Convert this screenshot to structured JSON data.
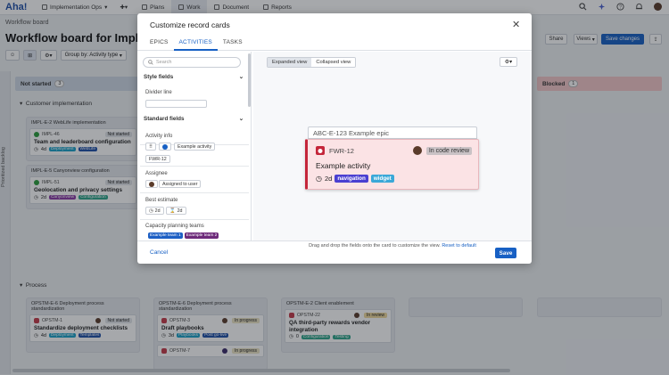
{
  "topnav": {
    "logo": "Aha!",
    "workspace": "Implementation Ops",
    "items": [
      {
        "label": "Plans"
      },
      {
        "label": "Work"
      },
      {
        "label": "Document"
      },
      {
        "label": "Reports"
      }
    ]
  },
  "page": {
    "breadcrumb": "Workflow board",
    "title": "Workflow board for Implem",
    "share_label": "Share",
    "views_label": "Views",
    "save_changes_label": "Save changes",
    "group_by_label": "Group by: Activity type",
    "side_tab_label": "Prioritized backlog"
  },
  "board": {
    "columns": [
      {
        "name": "Not started",
        "count": "3"
      },
      {
        "name": "Blocked",
        "count": "1"
      }
    ],
    "groups": [
      {
        "name": "Customer implementation"
      },
      {
        "name": "Process"
      }
    ],
    "customer_lanes": [
      {
        "title": "IMPL-E-2 WebLife implementation",
        "card": {
          "id": "IMPL-46",
          "title": "Team and leaderboard configuration",
          "estimate": "4d",
          "status": "Not started",
          "tags": [
            {
              "label": "Deployment",
              "color": "#1aa2c9"
            },
            {
              "label": "WebLife",
              "color": "#1d4fa8"
            }
          ]
        }
      },
      {
        "title": "IMPL-E-5 Canyonview configuration",
        "card": {
          "id": "IMPL-51",
          "title": "Geolocation and privacy settings",
          "estimate": "2d",
          "status": "Not started",
          "tags": [
            {
              "label": "Canyonview",
              "color": "#8b3aa6"
            },
            {
              "label": "Configuration",
              "color": "#2ea58a"
            }
          ]
        }
      }
    ],
    "process_lanes": [
      {
        "title": "OPSTM-E-6 Deployment process standardization",
        "card": {
          "id": "OPSTM-1",
          "title": "Standardize deployment checklists",
          "estimate": "4d",
          "status": "Not started",
          "status_color": "#e3e6ea",
          "tags": [
            {
              "label": "Deployment",
              "color": "#1aa2c9"
            },
            {
              "label": "Templates",
              "color": "#1d4fa8"
            }
          ]
        }
      },
      {
        "title": "OPSTM-E-6 Deployment process standardization",
        "card": {
          "id": "OPSTM-3",
          "title": "Draft playbooks",
          "estimate": "3d",
          "status": "In progress",
          "status_color": "#ece4c4",
          "tags": [
            {
              "label": "Playbooks",
              "color": "#1aa2c9"
            },
            {
              "label": "Post go-live",
              "color": "#1d4fa8"
            }
          ]
        },
        "card2": {
          "id": "OPSTM-7",
          "status": "In progress"
        }
      },
      {
        "title": "OPSTM-E-2 Client enablement",
        "card": {
          "id": "OPSTM-22",
          "title": "QA third-party rewards vendor integration",
          "estimate": "0",
          "status": "In review",
          "status_color": "#efd99c",
          "tags": [
            {
              "label": "Configuration",
              "color": "#2ea58a"
            },
            {
              "label": "Testing",
              "color": "#2ea58a"
            }
          ]
        }
      }
    ]
  },
  "modal": {
    "title": "Customize record cards",
    "tabs": [
      {
        "label": "EPICS"
      },
      {
        "label": "ACTIVITIES"
      },
      {
        "label": "TASKS"
      }
    ],
    "search_placeholder": "Search",
    "style_fields_label": "Style fields",
    "divider_line_label": "Divider line",
    "standard_fields_label": "Standard fields",
    "info_label": "Activity info",
    "info_example": "Example activity",
    "info_id": "FWR-12",
    "assignee_label": "Assignee",
    "assignee_value": "Assigned to user",
    "estimate_label": "Best estimate",
    "estimate_a": "2d",
    "estimate_b": "2d",
    "capacity_label": "Capacity planning teams",
    "capacity_tags": [
      {
        "label": "Example team 1",
        "color": "#1d5fc4"
      },
      {
        "label": "Example team 2",
        "color": "#6d2a7a"
      }
    ],
    "view_expanded": "Expanded view",
    "view_collapsed": "Collapsed view",
    "preview": {
      "epic": "ABC-E-123 Example epic",
      "id": "FWR-12",
      "status": "In code review",
      "title": "Example activity",
      "estimate": "2d",
      "tags": [
        {
          "label": "navigation",
          "color": "#4a3fd1"
        },
        {
          "label": "widget",
          "color": "#3aa8d8"
        }
      ]
    },
    "help_text": "Drag and drop the fields onto the card to customize the view.",
    "reset_label": "Reset to default",
    "cancel_label": "Cancel",
    "save_label": "Save"
  },
  "colors": {
    "accent": "#1760c4",
    "not_started_column": "#cfd8e6",
    "blocked_column": "#f4c7c8",
    "overlay": "rgba(20,25,35,0.38)"
  }
}
